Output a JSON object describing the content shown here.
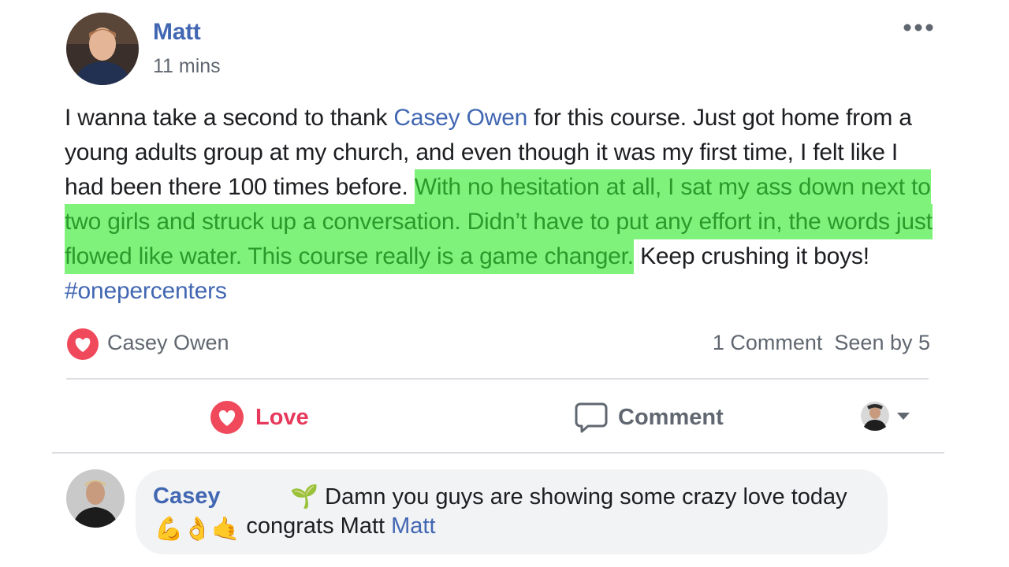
{
  "post": {
    "author": "Matt",
    "timestamp": "11 mins",
    "more_icon": "more-horizontal-icon",
    "body": {
      "part1": "I wanna take a second to thank ",
      "mention": "Casey Owen",
      "part2": " for this course. Just got home from a young adults group at my church, and even though it was my first time, I felt like I had been there 100 times before. ",
      "highlighted": "With no hesitation at all, I sat my ass down next to two girls and struck up a conversation. Didn’t have to put any effort in, the words just flowed like water. This course really is a game changer.",
      "part3": " Keep crushing it boys! ",
      "hashtag": "#onepercenters"
    },
    "highlight_color": "#7ff27c"
  },
  "reactions": {
    "icon": "heart-reaction-icon",
    "reactor": "Casey Owen",
    "comment_count": "1 Comment",
    "seen_by": "Seen by 5"
  },
  "actions": {
    "love_label": "Love",
    "love_color": "#e6395b",
    "comment_label": "Comment"
  },
  "comment": {
    "author": "Casey",
    "line1": "🌱 Damn you guys are showing some crazy love today",
    "emojis": "💪👌🤙",
    "line2_text": " congrats Matt ",
    "line2_mention": "Matt"
  }
}
